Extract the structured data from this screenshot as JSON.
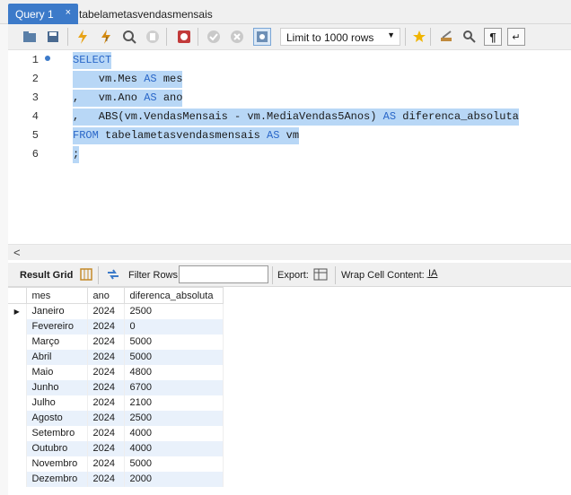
{
  "tabs": [
    {
      "label": "Query 1",
      "close": "×"
    },
    {
      "label": "tabelametasvendasmensais"
    }
  ],
  "toolbar": {
    "limit_label": "Limit to 1000 rows",
    "icons": [
      "folder-icon",
      "save-icon",
      "execute-icon",
      "execute-selection-icon",
      "explain-icon",
      "stop-icon",
      "toggle-error-icon",
      "commit-icon",
      "rollback-icon",
      "autocommit-icon",
      "add-snippet-icon",
      "beautify-icon",
      "find-icon",
      "invisible-chars-icon",
      "wrap-icon"
    ]
  },
  "editor": {
    "line_numbers": [
      "1",
      "2",
      "3",
      "4",
      "5",
      "6"
    ],
    "lines": [
      {
        "parts": [
          {
            "t": "SELECT",
            "kw": true
          }
        ]
      },
      {
        "parts": [
          {
            "t": "    vm.Mes "
          },
          {
            "t": "AS",
            "kw": true
          },
          {
            "t": " mes"
          }
        ]
      },
      {
        "parts": [
          {
            "t": ",   vm.Ano "
          },
          {
            "t": "AS",
            "kw": true
          },
          {
            "t": " ano"
          }
        ]
      },
      {
        "parts": [
          {
            "t": ",   ABS(vm.VendasMensais - vm.MediaVendas5Anos) "
          },
          {
            "t": "AS",
            "kw": true
          },
          {
            "t": " diferenca_absoluta"
          }
        ]
      },
      {
        "parts": [
          {
            "t": "FROM",
            "kw": true
          },
          {
            "t": " tabelametasvendasmensais "
          },
          {
            "t": "AS",
            "kw": true
          },
          {
            "t": " vm"
          }
        ]
      },
      {
        "parts": [
          {
            "t": ";"
          }
        ]
      }
    ]
  },
  "result": {
    "result_grid_label": "Result Grid",
    "filter_label": "Filter Rows:",
    "filter_value": "",
    "export_label": "Export:",
    "wrap_label": "Wrap Cell Content:",
    "columns": [
      "mes",
      "ano",
      "diferenca_absoluta"
    ],
    "rows": [
      [
        "Janeiro",
        "2024",
        "2500"
      ],
      [
        "Fevereiro",
        "2024",
        "0"
      ],
      [
        "Março",
        "2024",
        "5000"
      ],
      [
        "Abril",
        "2024",
        "5000"
      ],
      [
        "Maio",
        "2024",
        "4800"
      ],
      [
        "Junho",
        "2024",
        "6700"
      ],
      [
        "Julho",
        "2024",
        "2100"
      ],
      [
        "Agosto",
        "2024",
        "2500"
      ],
      [
        "Setembro",
        "2024",
        "4000"
      ],
      [
        "Outubro",
        "2024",
        "4000"
      ],
      [
        "Novembro",
        "2024",
        "5000"
      ],
      [
        "Dezembro",
        "2024",
        "2000"
      ]
    ],
    "current_row_indicator": "▶"
  },
  "colors": {
    "accent": "#3c7ac9",
    "selection": "#b8d7f6",
    "keyword": "#2a67c8",
    "row_alt": "#e9f1fb"
  }
}
